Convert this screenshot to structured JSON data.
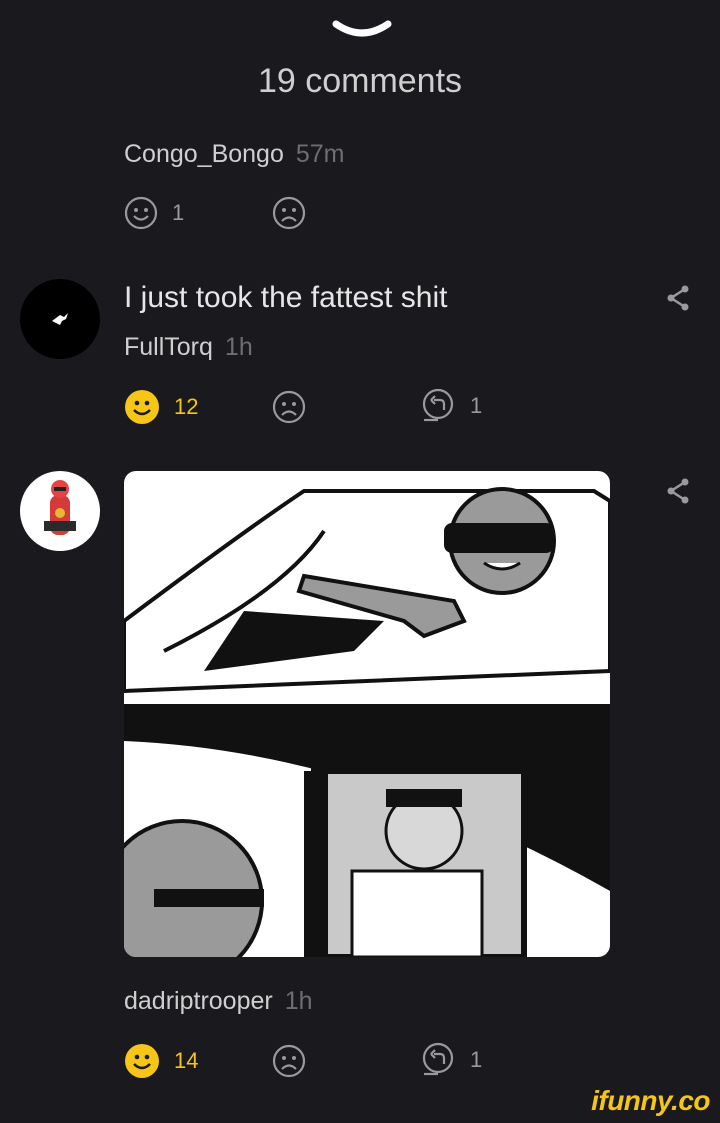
{
  "header": {
    "comments_count": "19 comments"
  },
  "comments": [
    {
      "author": "Congo_Bongo",
      "time": "57m",
      "smile_count": "1"
    },
    {
      "text": "I just took the fattest shit",
      "author": "FullTorq",
      "time": "1h",
      "smile_count": "12",
      "reply_count": "1"
    },
    {
      "author": "dadriptrooper",
      "time": "1h",
      "smile_count": "14",
      "reply_count": "1"
    }
  ],
  "watermark": "ifunny.co",
  "colors": {
    "background": "#1a1a1e",
    "accent_yellow": "#f5c518",
    "muted": "#6e6e72"
  },
  "icons": [
    "chevron-down-icon",
    "smile-icon",
    "frown-icon",
    "reply-icon",
    "share-icon"
  ]
}
